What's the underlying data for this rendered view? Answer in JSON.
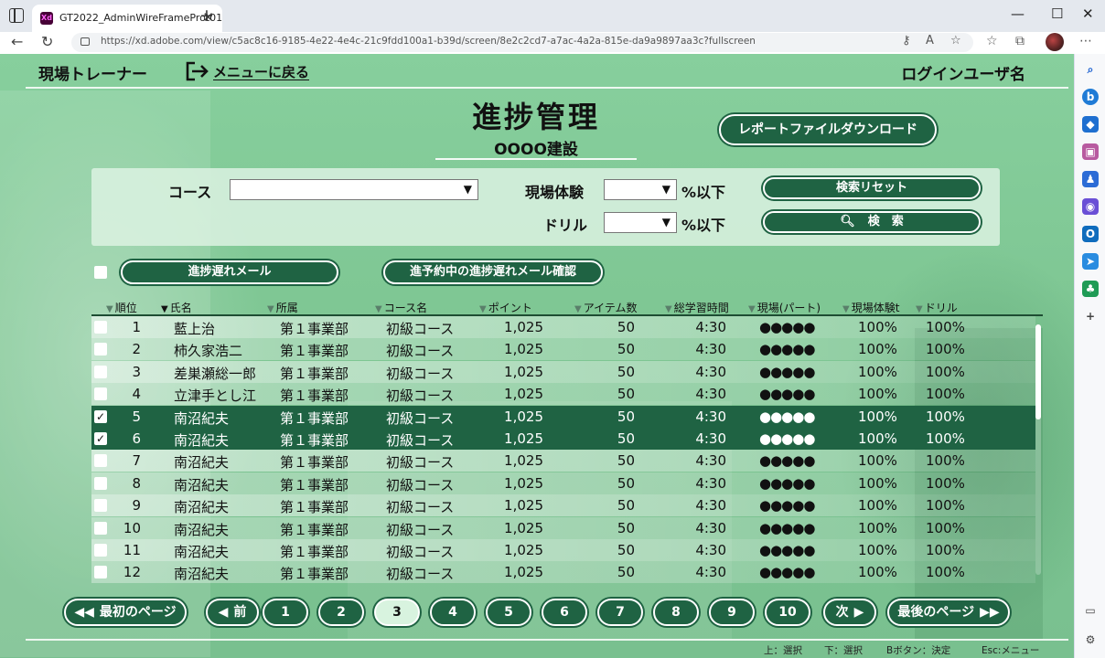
{
  "browser": {
    "tab_title": "GT2022_AdminWireFrameProt01",
    "url": "https://xd.adobe.com/view/c5ac8c16-9185-4e22-4e4c-21c9fdd100a1-b39d/screen/8e2c2cd7-a7ac-4a2a-815e-da9a9897aa3c?fullscreen",
    "xd_logo": "Xd"
  },
  "header": {
    "app_name": "現場トレーナー",
    "back_menu": "メニューに戻る",
    "user_name": "ログインユーザ名"
  },
  "title": {
    "page_title": "進捗管理",
    "company": "OOOO建設"
  },
  "report_button": "レポートファイルダウンロード",
  "search": {
    "course_label": "コース",
    "course_value": "",
    "field_label": "現場体験",
    "field_value": "",
    "drill_label": "ドリル",
    "drill_value": "",
    "percent_suffix": "%以下",
    "reset_button": "検索リセット",
    "search_button": "検　索"
  },
  "actions": {
    "mail_button": "進捗遅れメール",
    "confirm_button": "進予約中の進捗遅れメール確認"
  },
  "table": {
    "headers": [
      "順位",
      "氏名",
      "所属",
      "コース名",
      "ポイント",
      "アイテム数",
      "総学習時間",
      "現場(パート)",
      "現場体験t",
      "ドリル"
    ],
    "active_sort": 1,
    "rows": [
      {
        "rank": "1",
        "name": "藍上治",
        "dept": "第１事業部",
        "course": "初級コース",
        "points": "1,025",
        "items": "50",
        "time": "4:30",
        "dots": "●●●●●",
        "field": "100%",
        "drill": "100%",
        "checked": false
      },
      {
        "rank": "2",
        "name": "柿久家浩二",
        "dept": "第１事業部",
        "course": "初級コース",
        "points": "1,025",
        "items": "50",
        "time": "4:30",
        "dots": "●●●●●",
        "field": "100%",
        "drill": "100%",
        "checked": false
      },
      {
        "rank": "3",
        "name": "差巣瀬総一郎",
        "dept": "第１事業部",
        "course": "初級コース",
        "points": "1,025",
        "items": "50",
        "time": "4:30",
        "dots": "●●●●●",
        "field": "100%",
        "drill": "100%",
        "checked": false
      },
      {
        "rank": "4",
        "name": "立津手とし江",
        "dept": "第１事業部",
        "course": "初級コース",
        "points": "1,025",
        "items": "50",
        "time": "4:30",
        "dots": "●●●●●",
        "field": "100%",
        "drill": "100%",
        "checked": false
      },
      {
        "rank": "5",
        "name": "南沼紀夫",
        "dept": "第１事業部",
        "course": "初級コース",
        "points": "1,025",
        "items": "50",
        "time": "4:30",
        "dots": "●●●●●",
        "field": "100%",
        "drill": "100%",
        "checked": true
      },
      {
        "rank": "6",
        "name": "南沼紀夫",
        "dept": "第１事業部",
        "course": "初級コース",
        "points": "1,025",
        "items": "50",
        "time": "4:30",
        "dots": "●●●●●",
        "field": "100%",
        "drill": "100%",
        "checked": true
      },
      {
        "rank": "7",
        "name": "南沼紀夫",
        "dept": "第１事業部",
        "course": "初級コース",
        "points": "1,025",
        "items": "50",
        "time": "4:30",
        "dots": "●●●●●",
        "field": "100%",
        "drill": "100%",
        "checked": false
      },
      {
        "rank": "8",
        "name": "南沼紀夫",
        "dept": "第１事業部",
        "course": "初級コース",
        "points": "1,025",
        "items": "50",
        "time": "4:30",
        "dots": "●●●●●",
        "field": "100%",
        "drill": "100%",
        "checked": false
      },
      {
        "rank": "9",
        "name": "南沼紀夫",
        "dept": "第１事業部",
        "course": "初級コース",
        "points": "1,025",
        "items": "50",
        "time": "4:30",
        "dots": "●●●●●",
        "field": "100%",
        "drill": "100%",
        "checked": false
      },
      {
        "rank": "10",
        "name": "南沼紀夫",
        "dept": "第１事業部",
        "course": "初級コース",
        "points": "1,025",
        "items": "50",
        "time": "4:30",
        "dots": "●●●●●",
        "field": "100%",
        "drill": "100%",
        "checked": false
      },
      {
        "rank": "11",
        "name": "南沼紀夫",
        "dept": "第１事業部",
        "course": "初級コース",
        "points": "1,025",
        "items": "50",
        "time": "4:30",
        "dots": "●●●●●",
        "field": "100%",
        "drill": "100%",
        "checked": false
      },
      {
        "rank": "12",
        "name": "南沼紀夫",
        "dept": "第１事業部",
        "course": "初級コース",
        "points": "1,025",
        "items": "50",
        "time": "4:30",
        "dots": "●●●●●",
        "field": "100%",
        "drill": "100%",
        "checked": false
      }
    ]
  },
  "pagination": {
    "first": "最初のページ",
    "prev": "前",
    "pages": [
      "1",
      "2",
      "3",
      "4",
      "5",
      "6",
      "7",
      "8",
      "9",
      "10"
    ],
    "current_page": "3",
    "next": "次",
    "last": "最後のページ"
  },
  "hints": {
    "up": "上：選択",
    "down": "下：選択",
    "b_button": "Bボタン：決定",
    "esc": "Esc:メニュー"
  }
}
